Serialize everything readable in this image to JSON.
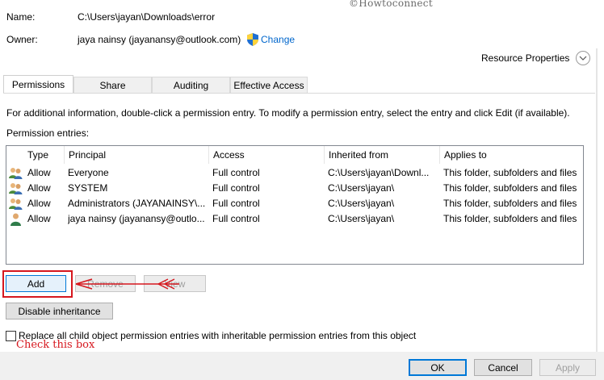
{
  "watermark": "©Howtoconnect",
  "name_label": "Name:",
  "name_value": "C:\\Users\\jayan\\Downloads\\error",
  "owner_label": "Owner:",
  "owner_value": "jaya nainsy (jayanansy@outlook.com)",
  "owner_change": "Change",
  "resource_properties": "Resource Properties",
  "tabs": [
    {
      "label": "Permissions",
      "active": true
    },
    {
      "label": "Share",
      "active": false
    },
    {
      "label": "Auditing",
      "active": false
    },
    {
      "label": "Effective Access",
      "active": false
    }
  ],
  "info_text": "For additional information, double-click a permission entry. To modify a permission entry, select the entry and click Edit (if available).",
  "entries_label": "Permission entries:",
  "columns": [
    "Type",
    "Principal",
    "Access",
    "Inherited from",
    "Applies to"
  ],
  "rows": [
    {
      "icon": "group-users-icon",
      "type": "Allow",
      "principal": "Everyone",
      "access": "Full control",
      "inherited": "C:\\Users\\jayan\\Downl...",
      "applies": "This folder, subfolders and files"
    },
    {
      "icon": "group-users-icon",
      "type": "Allow",
      "principal": "SYSTEM",
      "access": "Full control",
      "inherited": "C:\\Users\\jayan\\",
      "applies": "This folder, subfolders and files"
    },
    {
      "icon": "group-users-icon",
      "type": "Allow",
      "principal": "Administrators (JAYANAINSY\\...",
      "access": "Full control",
      "inherited": "C:\\Users\\jayan\\",
      "applies": "This folder, subfolders and files"
    },
    {
      "icon": "single-user-icon",
      "type": "Allow",
      "principal": "jaya nainsy (jayanansy@outlo...",
      "access": "Full control",
      "inherited": "C:\\Users\\jayan\\",
      "applies": "This folder, subfolders and files"
    }
  ],
  "buttons": {
    "add": "Add",
    "remove": "Remove",
    "view": "View",
    "disable_inheritance": "Disable inheritance",
    "ok": "OK",
    "cancel": "Cancel",
    "apply": "Apply"
  },
  "replace_checkbox": {
    "label": "Replace all child object permission entries with inheritable permission entries from this object",
    "checked": false
  },
  "annotation": "Check this box",
  "colors": {
    "annotation_red": "#d6171e",
    "link_blue": "#0066cc",
    "focus_blue": "#0078d7"
  }
}
